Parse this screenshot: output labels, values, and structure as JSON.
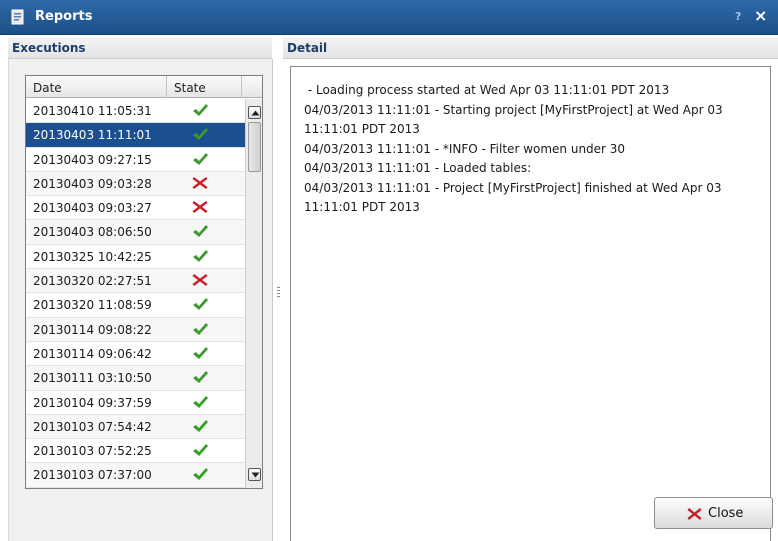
{
  "window": {
    "title": "Reports",
    "help_label": "?",
    "close_label": "×"
  },
  "executions": {
    "header": "Executions",
    "columns": {
      "date": "Date",
      "state": "State"
    },
    "rows": [
      {
        "date": "20130410 11:05:31",
        "state": "success"
      },
      {
        "date": "20130403 11:11:01",
        "state": "success",
        "selected": true
      },
      {
        "date": "20130403 09:27:15",
        "state": "success"
      },
      {
        "date": "20130403 09:03:28",
        "state": "failure"
      },
      {
        "date": "20130403 09:03:27",
        "state": "failure"
      },
      {
        "date": "20130403 08:06:50",
        "state": "success"
      },
      {
        "date": "20130325 10:42:25",
        "state": "success"
      },
      {
        "date": "20130320 02:27:51",
        "state": "failure"
      },
      {
        "date": "20130320 11:08:59",
        "state": "success"
      },
      {
        "date": "20130114 09:08:22",
        "state": "success"
      },
      {
        "date": "20130114 09:06:42",
        "state": "success"
      },
      {
        "date": "20130111 03:10:50",
        "state": "success"
      },
      {
        "date": "20130104 09:37:59",
        "state": "success"
      },
      {
        "date": "20130103 07:54:42",
        "state": "success"
      },
      {
        "date": "20130103 07:52:25",
        "state": "success"
      },
      {
        "date": "20130103 07:37:00",
        "state": "success"
      }
    ]
  },
  "detail": {
    "header": "Detail",
    "log_lines": [
      " - Loading process started at Wed Apr 03 11:11:01 PDT 2013",
      "04/03/2013 11:11:01 - Starting project [MyFirstProject] at Wed Apr 03 11:11:01 PDT 2013",
      "04/03/2013 11:11:01 - *INFO - Filter women under 30",
      "04/03/2013 11:11:01 - Loaded tables:",
      "04/03/2013 11:11:01 - Project [MyFirstProject] finished at Wed Apr 03 11:11:01 PDT 2013"
    ]
  },
  "close_button": {
    "label": "Close"
  },
  "colors": {
    "success": "#3a9a2c",
    "failure": "#c8202a",
    "selection": "#1c4f8f",
    "titlebar": "#1f5594"
  }
}
